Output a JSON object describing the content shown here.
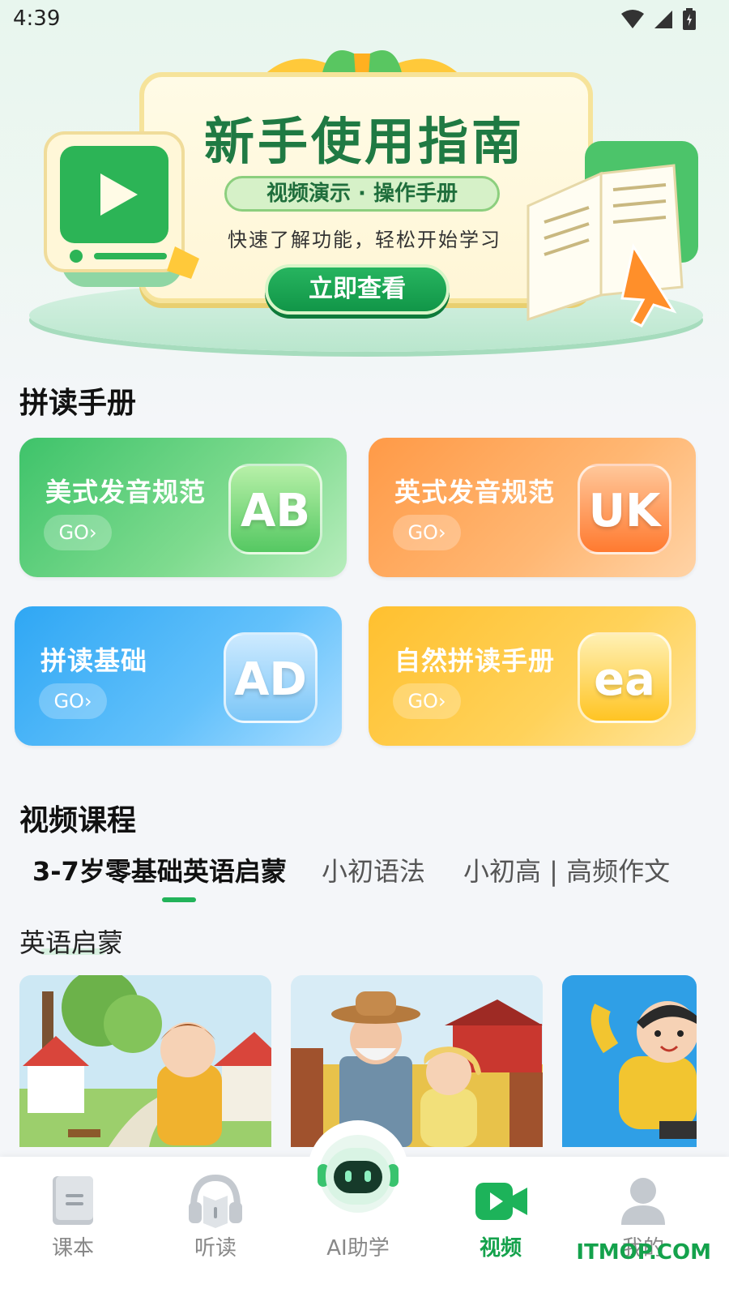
{
  "status_bar": {
    "time": "4:39"
  },
  "banner": {
    "title": "新手使用指南",
    "pill": "视频演示 · 操作手册",
    "subtitle": "快速了解功能，轻松开始学习",
    "button": "立即查看"
  },
  "phonics": {
    "section_title": "拼读手册",
    "cards": [
      {
        "title": "美式发音规范",
        "go": "GO›",
        "badge": "AB"
      },
      {
        "title": "英式发音规范",
        "go": "GO›",
        "badge": "UK"
      },
      {
        "title": "拼读基础",
        "go": "GO›",
        "badge": "AD"
      },
      {
        "title": "自然拼读手册",
        "go": "GO›",
        "badge": "ea"
      }
    ]
  },
  "videos": {
    "section_title": "视频课程",
    "tabs": [
      "3-7岁零基础英语启蒙",
      "小初语法",
      "小初高 | 高频作文"
    ],
    "active_tab": 0,
    "subsection": "英语启蒙"
  },
  "bottom_nav": {
    "items": [
      {
        "label": "课本",
        "icon": "textbook-icon"
      },
      {
        "label": "听读",
        "icon": "headphones-icon"
      },
      {
        "label": "AI助学",
        "icon": "robot-icon"
      },
      {
        "label": "视频",
        "icon": "video-camera-icon"
      },
      {
        "label": "我的",
        "icon": "user-icon"
      }
    ],
    "active_index": 3
  },
  "watermark": "ITMOP.COM",
  "colors": {
    "brand_green": "#14a24c",
    "indicator": "#22b35a"
  }
}
